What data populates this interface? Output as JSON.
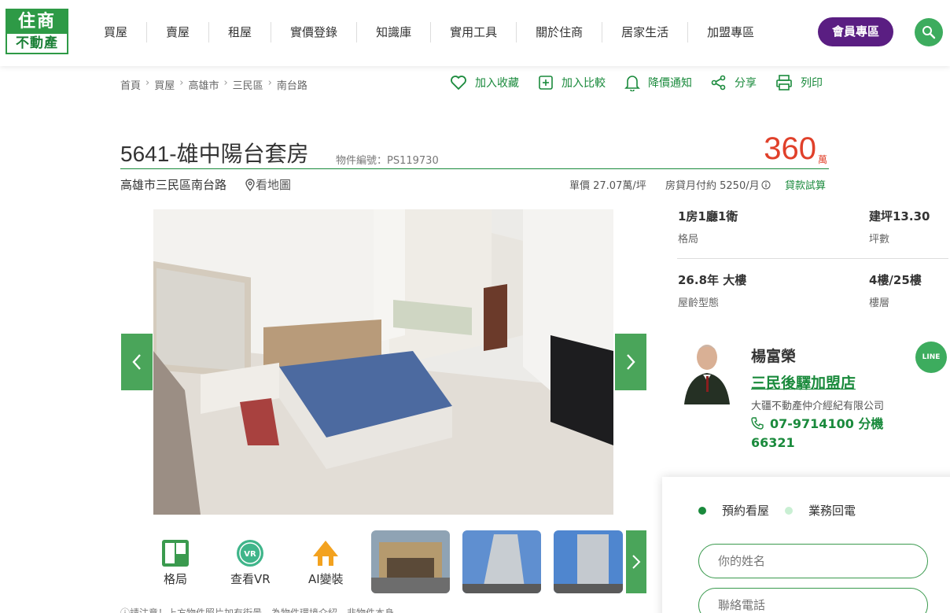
{
  "logo": {
    "top": "住商",
    "bottom": "不動產"
  },
  "nav": {
    "items": [
      "買屋",
      "賣屋",
      "租屋",
      "實價登錄",
      "知識庫",
      "實用工具",
      "關於住商",
      "居家生活",
      "加盟專區"
    ],
    "member_label": "會員專區"
  },
  "breadcrumb": [
    "首頁",
    "買屋",
    "高雄市",
    "三民區",
    "南台路"
  ],
  "actions": {
    "favorite": "加入收藏",
    "compare": "加入比較",
    "price_alert": "降價通知",
    "share": "分享",
    "print": "列印"
  },
  "listing": {
    "title": "5641-雄中陽台套房",
    "item_no": "物件編號：PS119730",
    "price": "360",
    "price_unit": "萬",
    "address": "高雄市三民區南台路",
    "map_link": "看地圖",
    "unit_price": "單價  27.07萬/坪",
    "loan_monthly": "房貸月付約  5250/月",
    "loan_calc": "貸款試算",
    "watermark": "住商不動產"
  },
  "specs": [
    {
      "value": "1房1廳1衛",
      "label": "格局"
    },
    {
      "value": "建坪13.30",
      "label": "坪數"
    },
    {
      "value": "26.8年 大樓",
      "label": "屋齡型態"
    },
    {
      "value": "4樓/25樓",
      "label": "樓層"
    }
  ],
  "tools": {
    "floorplan": "格局",
    "vr": "查看VR",
    "vr_badge": "VR",
    "ai": "AI變裝"
  },
  "disclaimer": "ⓘ請注意！上方物件照片加有街景，為物件環境介紹，非物件本身",
  "agent": {
    "name": "楊富榮",
    "store": "三民後驛加盟店",
    "company": "大疆不動產仲介經紀有限公司",
    "phone": "07-9714100 分機 66321",
    "line_label": "LINE"
  },
  "contact": {
    "tab_appointment": "預約看屋",
    "tab_callback": "業務回電",
    "name_placeholder": "你的姓名",
    "phone_placeholder": "聯絡電話"
  },
  "colors": {
    "brand_green": "#2e9a46",
    "price_red": "#e0402a",
    "member_purple": "#5a1e82"
  }
}
